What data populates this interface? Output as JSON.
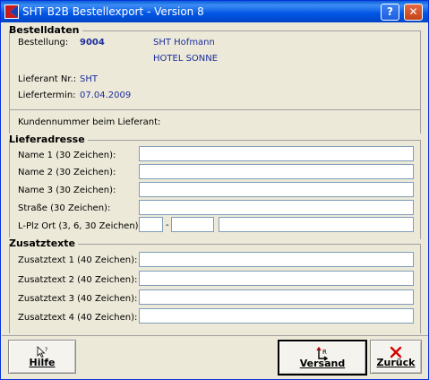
{
  "window": {
    "title": "SHT B2B Bestellexport - Version 8",
    "help_label": "?",
    "close_label": "✕"
  },
  "colors": {
    "value_text": "#1d2d9e",
    "titlebar": "#0054e3",
    "close_button": "#c44218"
  },
  "bestelldaten": {
    "title": "Bestelldaten",
    "bestellung_label": "Bestellung:",
    "bestellung_value": "9004",
    "customer_name": "SHT Hofmann",
    "customer_hotel": "HOTEL SONNE",
    "lieferant_label": "Lieferant Nr.:",
    "lieferant_value": "SHT",
    "liefertermin_label": "Liefertermin:",
    "liefertermin_value": "07.04.2009",
    "kundennummer_label": "Kundennummer beim Lieferant:"
  },
  "lieferadresse": {
    "title": "Lieferadresse",
    "name1_label": "Name 1 (30 Zeichen):",
    "name2_label": "Name 2 (30 Zeichen):",
    "name3_label": "Name 3 (30 Zeichen):",
    "strasse_label": "Straße (30 Zeichen):",
    "lplzort_label": "L-Plz Ort (3, 6, 30 Zeichen):",
    "dash": "-"
  },
  "zusatztexte": {
    "title": "Zusatztexte",
    "z1_label": "Zusatztext 1 (40 Zeichen):",
    "z2_label": "Zusatztext 2 (40 Zeichen):",
    "z3_label": "Zusatztext 3 (40 Zeichen):",
    "z4_label": "Zusatztext 4 (40 Zeichen):"
  },
  "buttons": {
    "hilfe": "Hilfe",
    "versand": "Versand",
    "zurueck": "Zurück"
  },
  "icons": {
    "app": "app-logo-icon",
    "hilfe": "help-cursor-icon",
    "versand": "send-arrows-icon",
    "zurueck": "red-x-icon"
  }
}
